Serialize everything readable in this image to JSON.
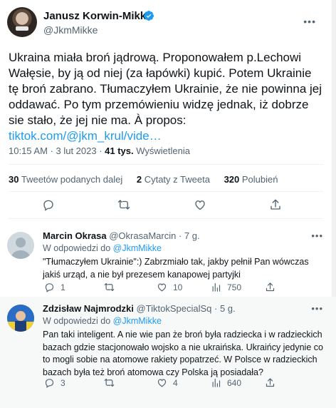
{
  "main": {
    "author_name": "Janusz Korwin-Mikke",
    "author_handle": "@JkmMikke",
    "text_plain": "Ukraina miała broń jądrową. Proponowałem p.Lechowi Wałęsie, by ją od niej (za łapówki) kupić. Potem Ukrainie tę broń zabrano. Tłumaczyłem Ukrainie, że nie powinna jej oddawać. Po tym przemówieniu widzę jednak, iż dobrze sie stało, że jej nie ma. À propos: ",
    "text_link": "tiktok.com/@jkm_krul/vide…",
    "time": "10:15 AM · 3 lut 2023 · ",
    "views_count": "41 tys.",
    "views_label": " Wyświetlenia",
    "retweets_count": "30",
    "retweets_label": " Tweetów podanych dalej",
    "quotes_count": "2",
    "quotes_label": " Cytaty z Tweeta",
    "likes_count": "320",
    "likes_label": " Polubień"
  },
  "replies": [
    {
      "name": "Marcin Okrasa",
      "handle_time": " @OkrasaMarcin · 7 g.",
      "reply_to_prefix": "W odpowiedzi do ",
      "reply_to_handle": "@JkmMikke",
      "text": "\"Tłumaczyłem Ukrainie\":) Zabrzmiało tak, jakby pełnił Pan wówczas jakiś urząd, a nie był prezesem kanapowej partyjki",
      "replies_count": "1",
      "retweets_count": "",
      "likes_count": "10",
      "views_count": "750"
    },
    {
      "name": "Zdzisław Najmrodzki",
      "handle_time": " @TiktokSpecialSq · 5 g.",
      "reply_to_prefix": "W odpowiedzi do ",
      "reply_to_handle": "@JkmMikke",
      "text": "Pan taki inteligent. A nie wie pan że broń była radziecka i w radzieckich bazach gdzie stacjonowało wojsko a nie ukraińska. Ukraińcy jedynie co to mogli sobie na atomowe rakiety popatrzeć. W Polsce w radzieckich bazach była też broń atomowa czy Polska ją posiadała?",
      "replies_count": "3",
      "retweets_count": "",
      "likes_count": "4",
      "views_count": "640"
    }
  ],
  "colors": {
    "link": "#1d9bf0",
    "secondary": "#536471",
    "text": "#0f1419",
    "divider": "#eff3f4"
  },
  "icons": [
    "verified-icon",
    "reply-icon",
    "retweet-icon",
    "like-icon",
    "bookmark-icon",
    "share-icon",
    "views-icon",
    "more-icon"
  ]
}
